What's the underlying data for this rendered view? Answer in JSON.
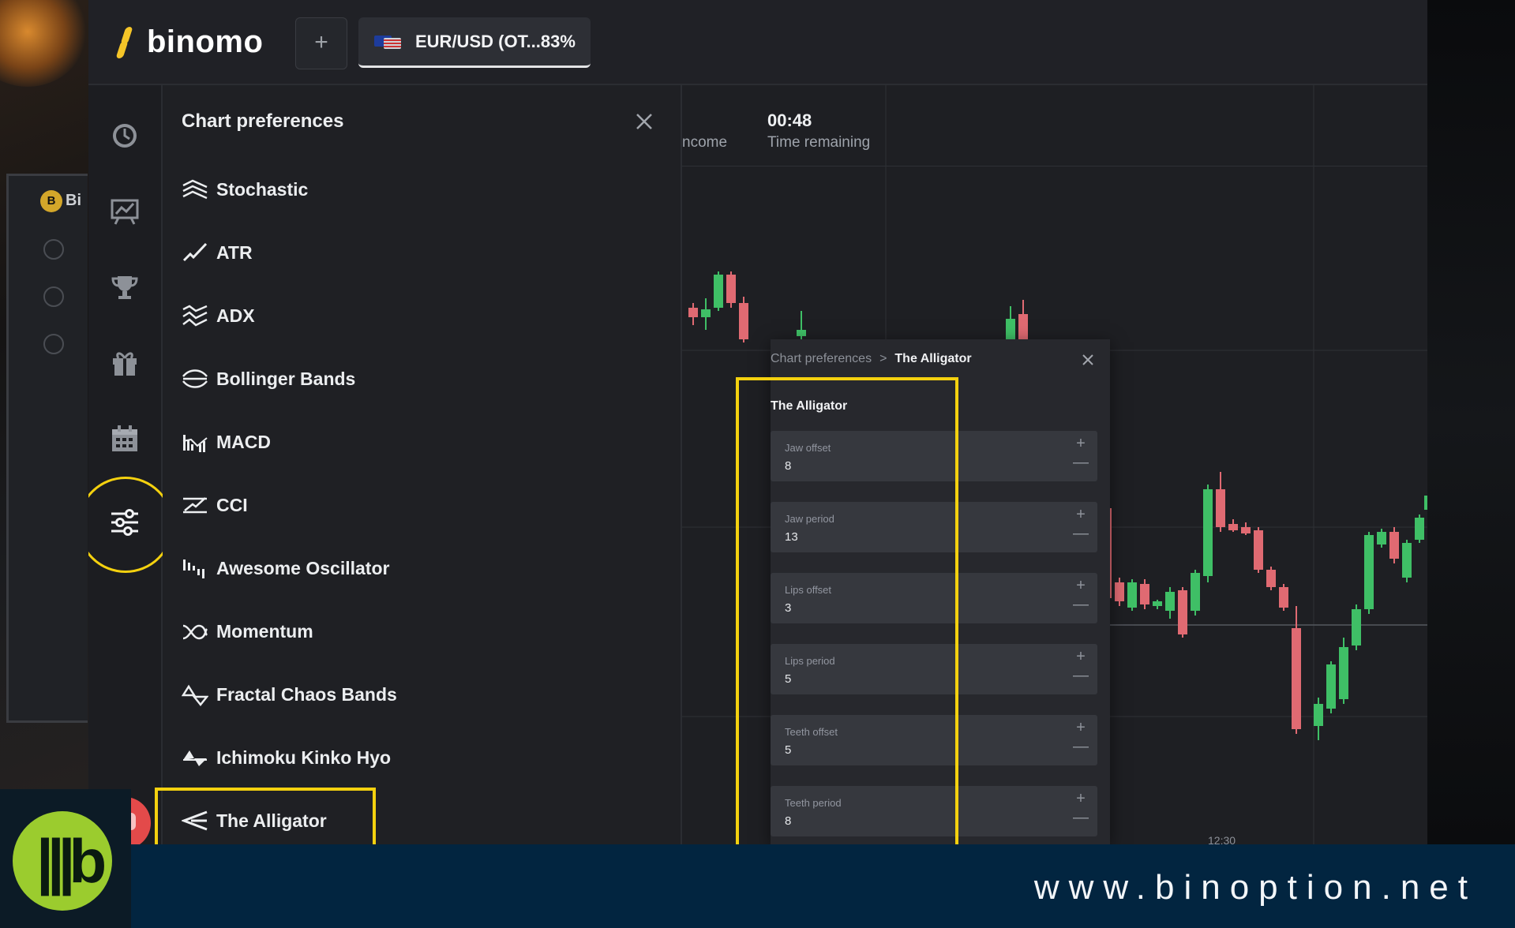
{
  "app": {
    "brand": "binomo"
  },
  "topbar": {
    "add_tab_label": "+",
    "asset_tab_label": "EUR/USD (OT...83%"
  },
  "chart_header": {
    "income_label": "ncome",
    "time_value": "00:48",
    "time_label": "Time remaining",
    "x_tick": "12:30"
  },
  "chart_preferences": {
    "title": "Chart preferences",
    "indicators": [
      {
        "label": "Stochastic",
        "icon": "stochastic-icon"
      },
      {
        "label": "ATR",
        "icon": "atr-icon"
      },
      {
        "label": "ADX",
        "icon": "adx-icon"
      },
      {
        "label": "Bollinger Bands",
        "icon": "bollinger-icon"
      },
      {
        "label": "MACD",
        "icon": "macd-icon"
      },
      {
        "label": "CCI",
        "icon": "cci-icon"
      },
      {
        "label": "Awesome Oscillator",
        "icon": "awesome-oscillator-icon"
      },
      {
        "label": "Momentum",
        "icon": "momentum-icon"
      },
      {
        "label": "Fractal Chaos Bands",
        "icon": "fractal-icon"
      },
      {
        "label": "Ichimoku Kinko Hyo",
        "icon": "ichimoku-icon"
      },
      {
        "label": "The Alligator",
        "icon": "alligator-icon"
      }
    ]
  },
  "alligator": {
    "breadcrumb_root": "Chart preferences",
    "breadcrumb_separator": ">",
    "breadcrumb_current": "The Alligator",
    "title": "The Alligator",
    "fields": [
      {
        "label": "Jaw offset",
        "value": "8"
      },
      {
        "label": "Jaw period",
        "value": "13"
      },
      {
        "label": "Lips offset",
        "value": "3"
      },
      {
        "label": "Lips period",
        "value": "5"
      },
      {
        "label": "Teeth offset",
        "value": "5"
      },
      {
        "label": "Teeth period",
        "value": "8"
      }
    ],
    "plus_glyph": "+",
    "minus_glyph": "—"
  },
  "colors": {
    "accent_highlight": "#f4d10f",
    "candle_up": "#3fbf66",
    "candle_down": "#e06a72",
    "brand_yellow": "#f5c528",
    "footer_bg": "#022540"
  },
  "footer": {
    "site": "www.binoption.net"
  },
  "laptop_bg": {
    "mini_logo": "B",
    "mini_text": "Bi"
  }
}
